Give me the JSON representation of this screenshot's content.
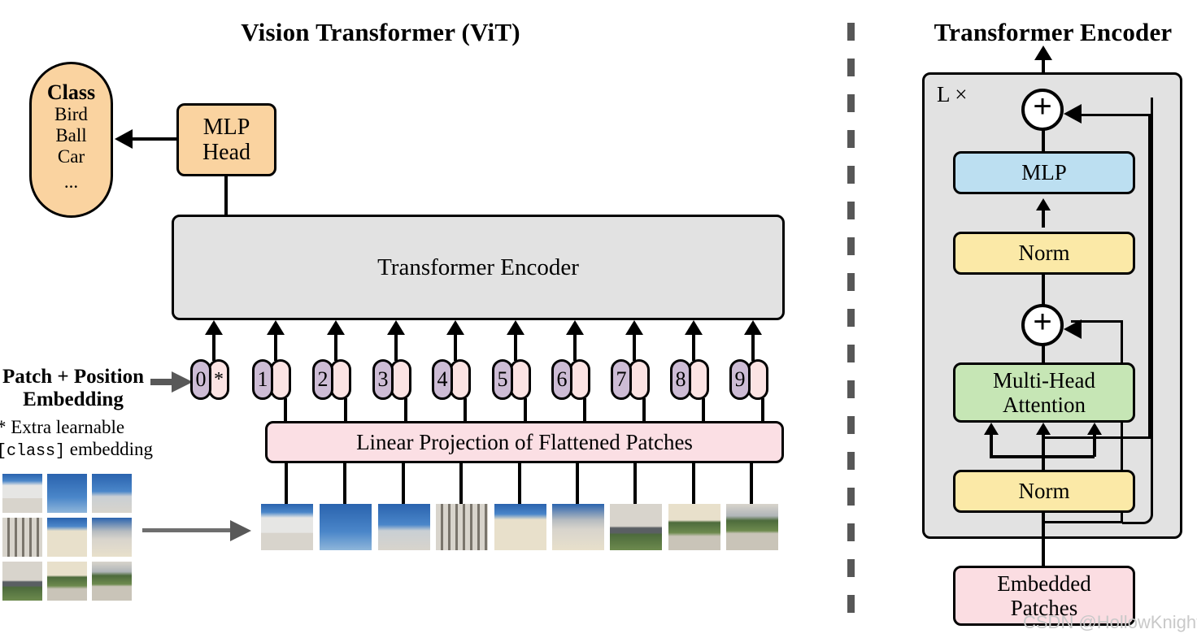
{
  "figure": {
    "left_title": "Vision Transformer (ViT)",
    "right_title": "Transformer Encoder",
    "watermark": "CSDN @HollowKnightZ"
  },
  "left_panel": {
    "class_bubble": {
      "heading": "Class",
      "items": [
        "Bird",
        "Ball",
        "Car"
      ],
      "ellipsis": "...",
      "color": "#fad3a0"
    },
    "mlp_head": {
      "line1": "MLP",
      "line2": "Head",
      "color": "#fad3a0"
    },
    "encoder_box": {
      "label": "Transformer Encoder",
      "color": "#e2e2e2"
    },
    "linear_projection": {
      "label": "Linear Projection of Flattened Patches",
      "color": "#fbdfe4"
    },
    "embedding_label": {
      "line1": "Patch + Position",
      "line2": "Embedding"
    },
    "footnote": {
      "line1": "* Extra learnable",
      "line2_code": "[class]",
      "line2_rest": " embedding"
    },
    "tokens": [
      {
        "index": "0",
        "star": "*",
        "has_star": true
      },
      {
        "index": "1",
        "star": "",
        "has_star": false
      },
      {
        "index": "2",
        "star": "",
        "has_star": false
      },
      {
        "index": "3",
        "star": "",
        "has_star": false
      },
      {
        "index": "4",
        "star": "",
        "has_star": false
      },
      {
        "index": "5",
        "star": "",
        "has_star": false
      },
      {
        "index": "6",
        "star": "",
        "has_star": false
      },
      {
        "index": "7",
        "star": "",
        "has_star": false
      },
      {
        "index": "8",
        "star": "",
        "has_star": false
      },
      {
        "index": "9",
        "star": "",
        "has_star": false
      }
    ],
    "token_colors": {
      "position": "#cdbcd5",
      "patch": "#fbe3e3"
    },
    "source_image_grid": {
      "rows": 3,
      "cols": 3,
      "description": "3x3 grid of photo patches of a palace facade with blue sky and garden"
    },
    "patch_strip": {
      "count": 9,
      "description": "row of 9 flattened image patches"
    }
  },
  "right_panel": {
    "repeat_label": "L ×",
    "blocks": [
      {
        "name": "mlp",
        "label": "MLP",
        "color": "#bcdff1"
      },
      {
        "name": "norm-top",
        "label": "Norm",
        "color": "#fbe9a7"
      },
      {
        "name": "multi-head-attention",
        "label": "Multi-Head\nAttention",
        "line1": "Multi-Head",
        "line2": "Attention",
        "color": "#c6e6b5"
      },
      {
        "name": "norm-bottom",
        "label": "Norm",
        "color": "#fbe9a7"
      },
      {
        "name": "embedded-patches",
        "line1": "Embedded",
        "line2": "Patches",
        "color": "#fbdde2"
      }
    ],
    "adders": [
      {
        "symbol": "+"
      },
      {
        "symbol": "+"
      }
    ],
    "container_color": "#e2e2e2"
  }
}
